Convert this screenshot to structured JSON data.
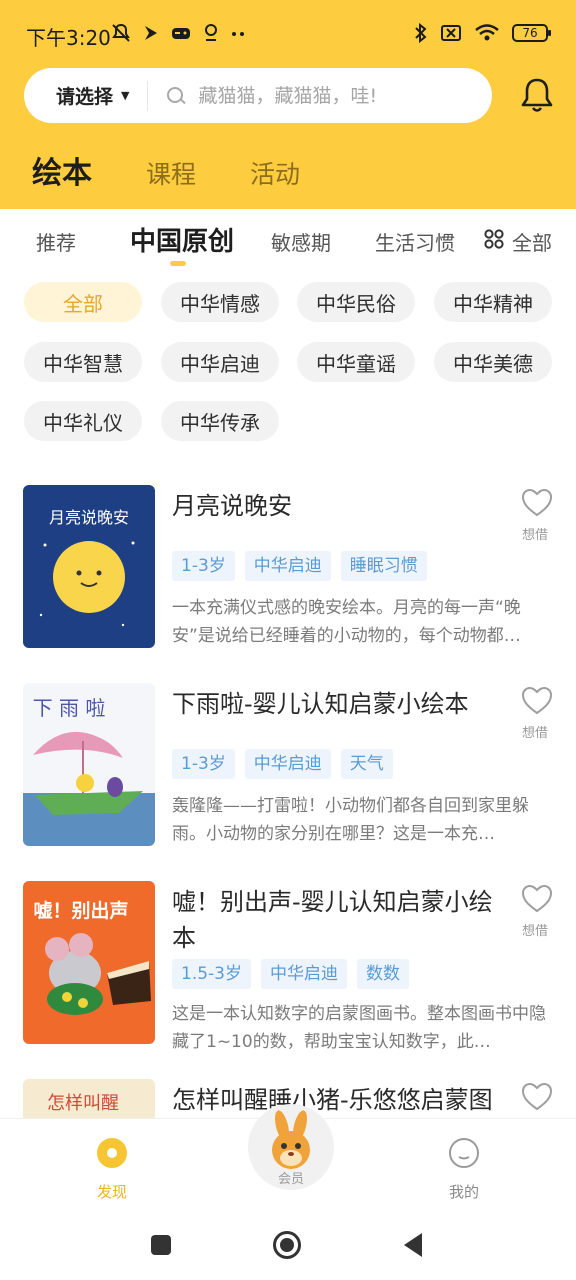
{
  "status_bar": {
    "time": "下午3:20",
    "battery": "76"
  },
  "search": {
    "selector_label": "请选择",
    "placeholder": "藏猫猫，藏猫猫，哇!"
  },
  "main_tabs": [
    {
      "label": "绘本",
      "active": true
    },
    {
      "label": "课程",
      "active": false
    },
    {
      "label": "活动",
      "active": false
    }
  ],
  "sub_tabs": [
    {
      "label": "推荐",
      "active": false
    },
    {
      "label": "中国原创",
      "active": true
    },
    {
      "label": "敏感期",
      "active": false
    },
    {
      "label": "生活习惯",
      "active": false
    }
  ],
  "sub_tabs_all_label": "全部",
  "filter_chips": [
    {
      "label": "全部",
      "active": true
    },
    {
      "label": "中华情感",
      "active": false
    },
    {
      "label": "中华民俗",
      "active": false
    },
    {
      "label": "中华精神",
      "active": false
    },
    {
      "label": "中华智慧",
      "active": false
    },
    {
      "label": "中华启迪",
      "active": false
    },
    {
      "label": "中华童谣",
      "active": false
    },
    {
      "label": "中华美德",
      "active": false
    },
    {
      "label": "中华礼仪",
      "active": false
    },
    {
      "label": "中华传承",
      "active": false
    }
  ],
  "books": [
    {
      "title": "月亮说晚安",
      "cover_text": "月亮说晚安",
      "tags": [
        "1-3岁",
        "中华启迪",
        "睡眠习惯"
      ],
      "description": "一本充满仪式感的晚安绘本。月亮的每一声“晚安”是说给已经睡着的小动物的，每个动物都…",
      "fav_label": "想借"
    },
    {
      "title": "下雨啦-婴儿认知启蒙小绘本",
      "cover_text": "下 雨 啦",
      "tags": [
        "1-3岁",
        "中华启迪",
        "天气"
      ],
      "description": "轰隆隆——打雷啦！小动物们都各自回到家里躲雨。小动物的家分别在哪里？这是一本充…",
      "fav_label": "想借"
    },
    {
      "title": "嘘！别出声-婴儿认知启蒙小绘本",
      "cover_text": "嘘！别出声",
      "tags": [
        "1.5-3岁",
        "中华启迪",
        "数数"
      ],
      "description": "这是一本认知数字的启蒙图画书。整本图画书中隐藏了1~10的数，帮助宝宝认知数字，此…",
      "fav_label": "想借"
    },
    {
      "title": "怎样叫醒睡小猪-乐悠悠启蒙图",
      "cover_text": "怎样叫醒",
      "tags": [],
      "description": "",
      "fav_label": ""
    }
  ],
  "bottom_nav": {
    "discover": "发现",
    "vip": "会员",
    "mine": "我的"
  },
  "colors": {
    "brand_yellow": "#fdcd3f",
    "tag_blue": "#5a9bd6",
    "active_orange": "#f0b51d"
  }
}
